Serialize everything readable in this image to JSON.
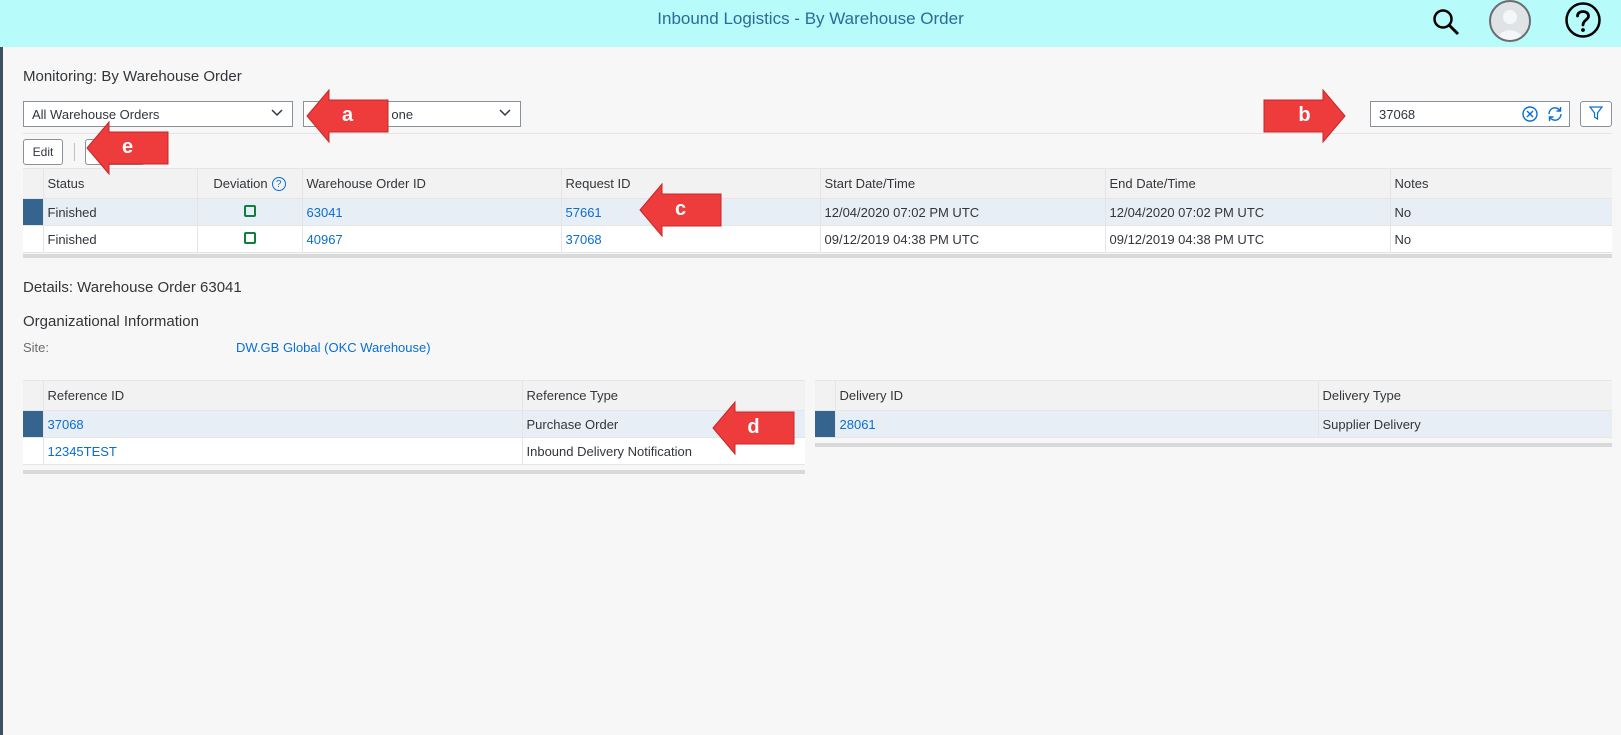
{
  "header": {
    "title": "Inbound Logistics - By Warehouse Order"
  },
  "page": {
    "title": "Monitoring: By Warehouse Order"
  },
  "filters": {
    "view_select": "All Warehouse Orders",
    "second_select_prefix": "C",
    "second_select": "one"
  },
  "search": {
    "value": "37068"
  },
  "toolbar": {
    "edit_label": "Edit"
  },
  "main_table": {
    "columns": [
      "Status",
      "Deviation",
      "Warehouse Order ID",
      "Request ID",
      "Start Date/Time",
      "End Date/Time",
      "Notes"
    ],
    "rows": [
      {
        "status": "Finished",
        "warehouse_order_id": "63041",
        "request_id": "57661",
        "start": "12/04/2020 07:02 PM UTC",
        "end": "12/04/2020 07:02 PM UTC",
        "notes": "No"
      },
      {
        "status": "Finished",
        "warehouse_order_id": "40967",
        "request_id": "37068",
        "start": "09/12/2019 04:38 PM UTC",
        "end": "09/12/2019 04:38 PM UTC",
        "notes": "No"
      }
    ]
  },
  "details": {
    "title": "Details: Warehouse Order 63041",
    "org_title": "Organizational Information",
    "site_label": "Site:",
    "site_value": "DW.GB Global (OKC Warehouse)"
  },
  "reference_table": {
    "columns": [
      "Reference ID",
      "Reference Type"
    ],
    "rows": [
      {
        "id": "37068",
        "type": "Purchase Order"
      },
      {
        "id": "12345TEST",
        "type": "Inbound Delivery Notification"
      }
    ]
  },
  "delivery_table": {
    "columns": [
      "Delivery ID",
      "Delivery Type"
    ],
    "rows": [
      {
        "id": "28061",
        "type": "Supplier Delivery"
      }
    ]
  },
  "annotations": {
    "a": "a",
    "b": "b",
    "c": "c",
    "d": "d",
    "e": "e"
  },
  "colors": {
    "header_bg": "#b8fbfb",
    "link": "#0a6ed1",
    "selection": "#35648f",
    "arrow": "#ee3b3b"
  }
}
